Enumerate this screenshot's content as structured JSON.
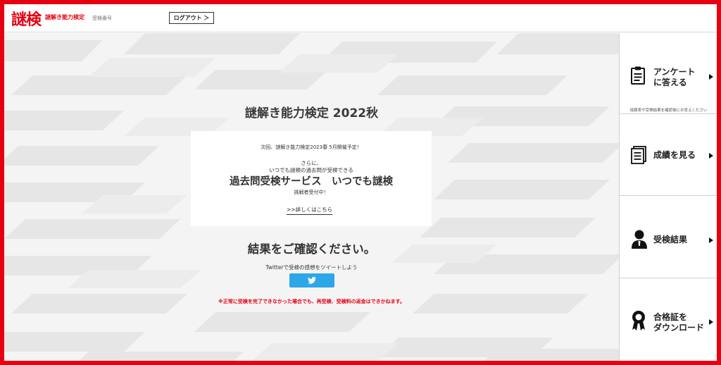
{
  "header": {
    "logo": "謎検",
    "logo_sub": "謎解き能力検定",
    "exam_number_label": "受検番号",
    "logout_label": "ログアウト ＞"
  },
  "main": {
    "title": "謎解き能力検定 2022秋",
    "notice": {
      "next_exam": "次回、謎解き能力検定2023春 5月開催予定！",
      "furthermore": "さらに、",
      "anytime": "いつでも謎検の過去問が受検できる",
      "service": "過去問受検サービス　いつでも謎検",
      "challenger": "挑戦者受付中！",
      "details_link": ">>詳しくはこちら"
    },
    "confirm_heading": "結果をご確認ください。",
    "tweet_text": "Twitterで受検の感想をツイートしよう",
    "twitter_icon": "twitter-bird-icon",
    "warning": "※正常に受検を完了できなかった場合でも、再受検、受検料の返金はできかねます。"
  },
  "sidebar": {
    "survey": {
      "icon": "clipboard-icon",
      "line1": "アンケート",
      "line2": "に答える",
      "note": "成績表や受検結果を確認後にお答えください"
    },
    "view_grades": {
      "icon": "document-stack-icon",
      "label": "成績を見る"
    },
    "exam_result": {
      "icon": "person-icon",
      "label": "受検結果"
    },
    "certificate": {
      "icon": "medal-icon",
      "line1": "合格証を",
      "line2": "ダウンロード"
    }
  },
  "colors": {
    "brand_red": "#e60012",
    "twitter_blue": "#2da7e8",
    "background_gray": "#f4f4f4"
  }
}
